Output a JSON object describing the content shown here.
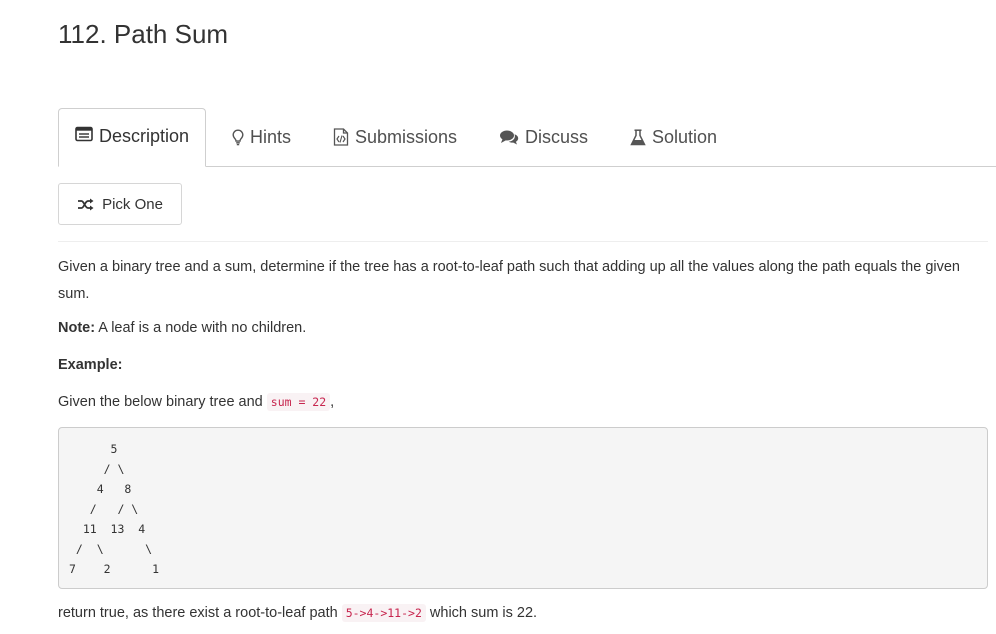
{
  "problem": {
    "title": "112. Path Sum"
  },
  "tabs": [
    {
      "label": "Description",
      "icon": "description-icon"
    },
    {
      "label": "Hints",
      "icon": "lightbulb-icon"
    },
    {
      "label": "Submissions",
      "icon": "code-file-icon"
    },
    {
      "label": "Discuss",
      "icon": "chat-bubbles-icon"
    },
    {
      "label": "Solution",
      "icon": "flask-icon"
    }
  ],
  "pick_one": {
    "label": "Pick One",
    "icon": "shuffle-icon"
  },
  "description": {
    "intro": "Given a binary tree and a sum, determine if the tree has a root-to-leaf path such that adding up all the values along the path equals the given sum.",
    "note_label": "Note:",
    "note_text": " A leaf is a node with no children.",
    "example_label": "Example:",
    "given_prefix": "Given the below binary tree and ",
    "given_code": "sum = 22",
    "given_suffix": ",",
    "tree": "      5\n     / \\\n    4   8\n   /   / \\\n  11  13  4\n /  \\      \\\n7    2      1",
    "return_prefix": "return true, as there exist a root-to-leaf path ",
    "return_code": "5->4->11->2",
    "return_suffix": " which sum is 22."
  }
}
